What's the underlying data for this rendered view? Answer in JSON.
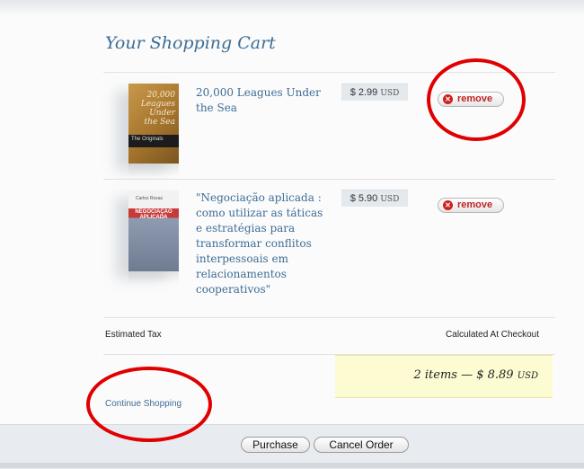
{
  "cart": {
    "title": "Your Shopping Cart",
    "items": [
      {
        "title": "20,000 Leagues Under the Sea",
        "price": "$ 2.99",
        "currency": "USD",
        "remove_label": "remove",
        "cover": {
          "text": "20,000 Leagues Under the Sea",
          "series": "The Originals"
        }
      },
      {
        "title": "\"Negociação aplicada : como utilizar as táticas e estratégias para transformar conflitos interpessoais em relacionamentos cooperativos\"",
        "price": "$ 5.90",
        "currency": "USD",
        "remove_label": "remove",
        "cover": {
          "author": "Carlos Rosas",
          "brand": "NEGOCIAÇÃO APLICADA"
        }
      }
    ],
    "tax": {
      "label": "Estimated Tax",
      "value": "Calculated At Checkout"
    },
    "total": {
      "summary": "2 items — $ 8.89",
      "currency": "USD"
    },
    "continue_label": "Continue Shopping"
  },
  "actions": {
    "purchase_label": "Purchase",
    "cancel_label": "Cancel Order"
  },
  "colors": {
    "accent": "#3d6d96",
    "remove": "#c02424",
    "total_bg": "#fdfbd1",
    "annotation": "#e00000"
  }
}
